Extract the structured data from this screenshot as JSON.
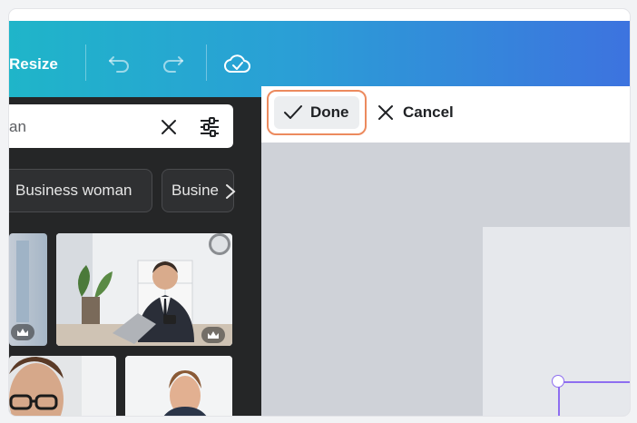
{
  "toolbar": {
    "resize_label": "Resize",
    "undo_icon": "undo-icon",
    "redo_icon": "redo-icon",
    "cloud_icon": "cloud-saved-icon",
    "gradient_start": "#1fb5c9",
    "gradient_end": "#3d73df"
  },
  "search": {
    "value_visible": "an",
    "clear_icon": "close-icon",
    "filter_icon": "filter-sliders-icon"
  },
  "chips": [
    {
      "label": "Business woman"
    },
    {
      "label": "Busine"
    }
  ],
  "chips_next_icon": "chevron-right-icon",
  "edit_bar": {
    "done_label": "Done",
    "cancel_label": "Cancel",
    "highlight_color": "#ec8a5e"
  },
  "photos": {
    "premium_icon": "crown-icon"
  },
  "colors": {
    "panel_bg": "#252627",
    "canvas_bg": "#cfd2d8",
    "selection": "#8e6ef0"
  }
}
